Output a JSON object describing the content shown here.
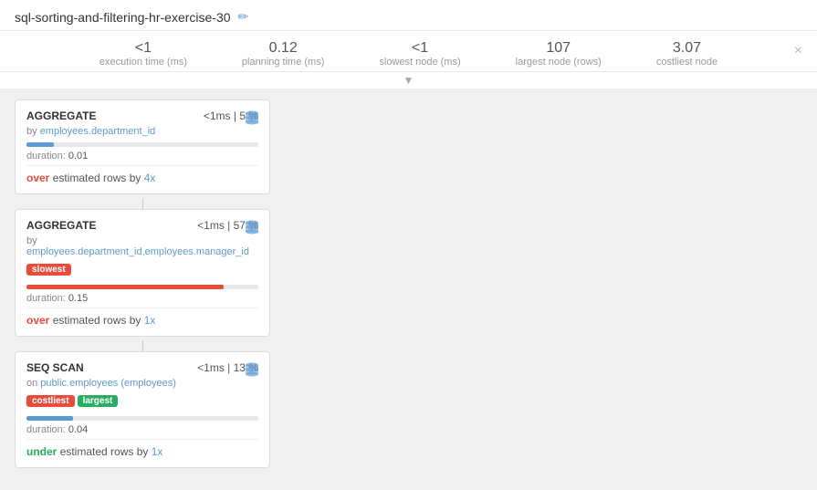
{
  "header": {
    "title": "sql-sorting-and-filtering-hr-exercise-30",
    "edit_icon": "✏"
  },
  "stats": [
    {
      "value": "<1",
      "label": "execution time (ms)"
    },
    {
      "value": "0.12",
      "label": "planning time (ms)"
    },
    {
      "value": "<1",
      "label": "slowest node (ms)"
    },
    {
      "value": "107",
      "label": "largest node (rows)"
    },
    {
      "value": "3.07",
      "label": "costliest node"
    }
  ],
  "close_btn": "×",
  "nodes": [
    {
      "type": "AGGREGATE",
      "time": "<1ms",
      "pct": "5 %",
      "detail_prefix": "by",
      "detail_value": "employees.department_id",
      "badges": [],
      "progress_pct": 12,
      "progress_color": "#5b9bd5",
      "duration_label": "duration:",
      "duration_value": "0.01",
      "estimated": "over",
      "estimated_text": "over estimated rows by",
      "estimated_suffix": "4x"
    },
    {
      "type": "AGGREGATE",
      "time": "<1ms",
      "pct": "57 %",
      "detail_prefix": "by",
      "detail_value": "employees.department_id,employees.manager_id",
      "badges": [
        "slowest"
      ],
      "progress_pct": 85,
      "progress_color": "#e74c3c",
      "duration_label": "duration:",
      "duration_value": "0.15",
      "estimated": "over",
      "estimated_text": "over estimated rows by",
      "estimated_suffix": "1x"
    },
    {
      "type": "SEQ SCAN",
      "time": "<1ms",
      "pct": "13 %",
      "detail_prefix": "on",
      "detail_value": "public.employees (employees)",
      "badges": [
        "costliest",
        "largest"
      ],
      "progress_pct": 20,
      "progress_color": "#5b9bd5",
      "duration_label": "duration:",
      "duration_value": "0.04",
      "estimated": "under",
      "estimated_text": "under estimated rows by",
      "estimated_suffix": "1x"
    }
  ]
}
